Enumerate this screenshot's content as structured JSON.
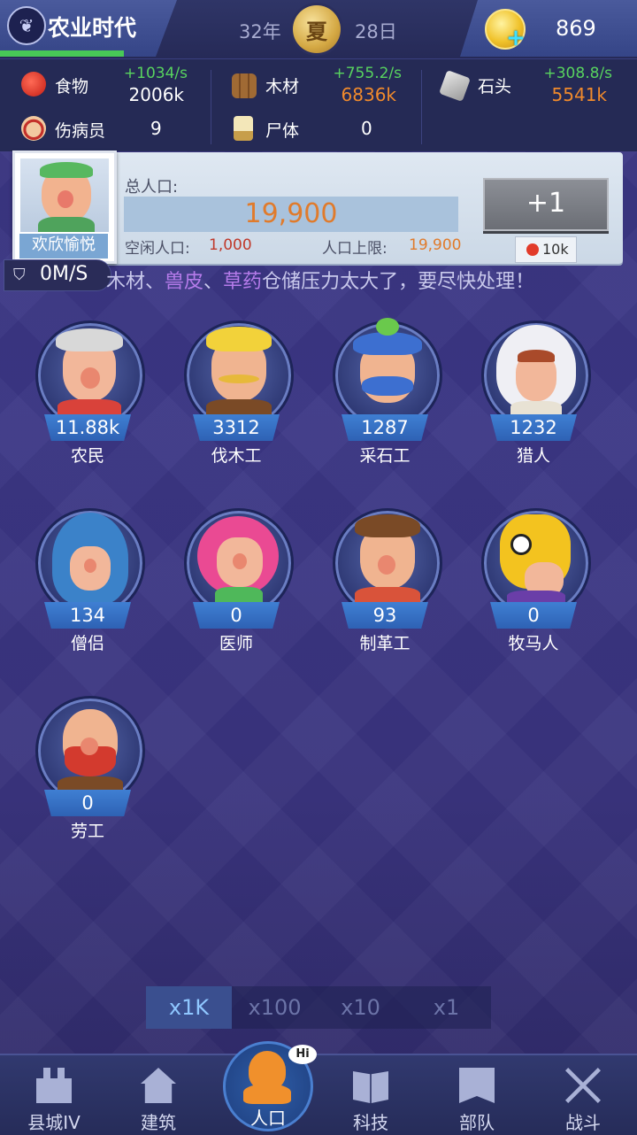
{
  "header": {
    "era_title": "农业时代",
    "year": "32年",
    "season": "夏",
    "day": "28日",
    "coins": "869"
  },
  "resources": [
    {
      "name": "食物",
      "rate": "+1034/s",
      "amount": "2006k",
      "icon": "apple-icon",
      "amount_color": "#ffffff"
    },
    {
      "name": "木材",
      "rate": "+755.2/s",
      "amount": "6836k",
      "icon": "wood-logs-icon",
      "amount_color": "#f08a2c"
    },
    {
      "name": "石头",
      "rate": "+308.8/s",
      "amount": "5541k",
      "icon": "stone-icon",
      "amount_color": "#f08a2c"
    }
  ],
  "counters": [
    {
      "name": "伤病员",
      "value": "9",
      "icon": "injured-icon"
    },
    {
      "name": "尸体",
      "value": "0",
      "icon": "corpse-icon"
    }
  ],
  "population": {
    "total_label": "总人口:",
    "total": "19,900",
    "idle_label": "空闲人口:",
    "idle": "1,000",
    "cap_label": "人口上限:",
    "cap": "19,900",
    "mood": "欢欣愉悦",
    "add_button": "+1",
    "add_cost": "10k"
  },
  "status": {
    "speed": "0M/S",
    "warning_prefix": "木材、",
    "warning_hl1": "兽皮",
    "warning_mid": "、",
    "warning_hl2": "草药",
    "warning_suffix": "仓储压力太大了，要尽快处理！"
  },
  "workers": [
    {
      "name": "农民",
      "count": "11.88k"
    },
    {
      "name": "伐木工",
      "count": "3312"
    },
    {
      "name": "采石工",
      "count": "1287"
    },
    {
      "name": "猎人",
      "count": "1232"
    },
    {
      "name": "僧侣",
      "count": "134"
    },
    {
      "name": "医师",
      "count": "0"
    },
    {
      "name": "制革工",
      "count": "93"
    },
    {
      "name": "牧马人",
      "count": "0"
    },
    {
      "name": "劳工",
      "count": "0"
    }
  ],
  "multipliers": [
    "x1K",
    "x100",
    "x10",
    "x1"
  ],
  "multiplier_selected": "x1K",
  "nav": [
    {
      "label": "县城IV",
      "icon": "castle-icon"
    },
    {
      "label": "建筑",
      "icon": "house-icon"
    },
    {
      "label": "人口",
      "icon": "person-icon",
      "badge": "Hi"
    },
    {
      "label": "科技",
      "icon": "book-icon"
    },
    {
      "label": "部队",
      "icon": "banner-icon"
    },
    {
      "label": "战斗",
      "icon": "crossed-swords-icon"
    }
  ],
  "colors": {
    "accent_green": "#58d35f",
    "accent_orange": "#e07b2c",
    "nav_selected": "#2f5ea8"
  }
}
